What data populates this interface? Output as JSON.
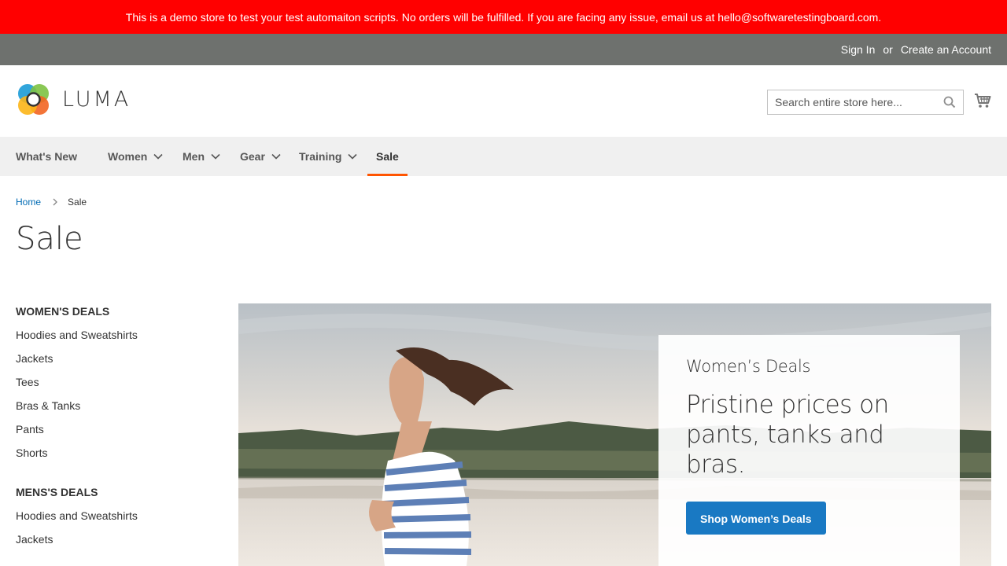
{
  "banner": {
    "text": "This is a demo store to test your test automaiton scripts. No orders will be fulfilled. If you are facing any issue, email us at hello@softwaretestingboard.com."
  },
  "header_links": {
    "sign_in": "Sign In",
    "or": "or",
    "create_account": "Create an Account"
  },
  "logo": {
    "text": "LUMA",
    "icon": "luma-logo-icon"
  },
  "search": {
    "placeholder": "Search entire store here...",
    "icon": "search-icon"
  },
  "cart": {
    "icon": "cart-icon"
  },
  "nav": {
    "items": [
      {
        "label": "What's New",
        "has_submenu": false
      },
      {
        "label": "Women",
        "has_submenu": true
      },
      {
        "label": "Men",
        "has_submenu": true
      },
      {
        "label": "Gear",
        "has_submenu": true
      },
      {
        "label": "Training",
        "has_submenu": true
      },
      {
        "label": "Sale",
        "has_submenu": false,
        "active": true
      }
    ]
  },
  "breadcrumb": {
    "home": "Home",
    "current": "Sale"
  },
  "page_title": "Sale",
  "sidebar": {
    "groups": [
      {
        "heading": "WOMEN'S DEALS",
        "items": [
          "Hoodies and Sweatshirts",
          "Jackets",
          "Tees",
          "Bras & Tanks",
          "Pants",
          "Shorts"
        ]
      },
      {
        "heading": "MENS'S DEALS",
        "items": [
          "Hoodies and Sweatshirts",
          "Jackets"
        ]
      }
    ]
  },
  "promo": {
    "kicker": "Women’s Deals",
    "headline": "Pristine prices on pants, tanks and bras.",
    "cta": "Shop Women’s Deals"
  },
  "colors": {
    "banner_bg": "#ff0000",
    "header_bar": "#6e716e",
    "nav_bg": "#f0f0f0",
    "nav_active": "#ff5501",
    "link": "#006bb4",
    "button": "#1979c3"
  }
}
